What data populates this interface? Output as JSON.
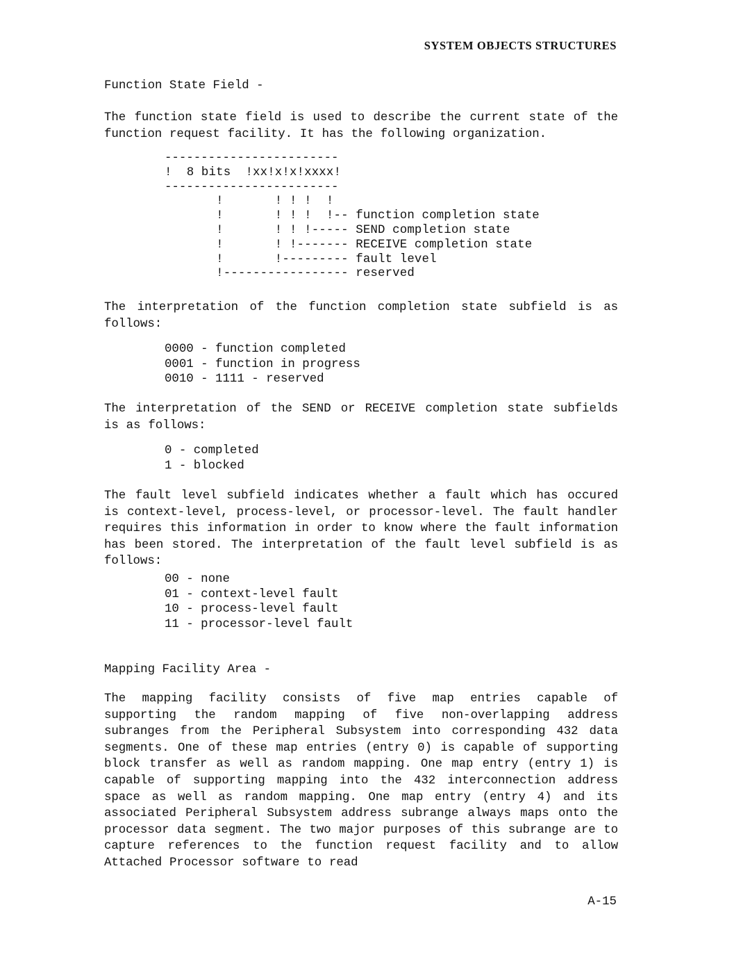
{
  "document": {
    "running_head": "SYSTEM OBJECTS STRUCTURES",
    "page_number": "A-15"
  },
  "sections": {
    "function_state_field": {
      "heading": "Function State Field -",
      "intro": "The function state field is used to describe the current state of the function request facility.  It has the following organization.",
      "diagram": {
        "top_rule": "------------------------",
        "header_row": "!  8 bits  !xx!x!x!xxxx!",
        "bottom_rule": "------------------------",
        "lines": [
          "       !       ! ! !  !",
          "       !       ! ! !  !-- function completion state",
          "       !       ! ! !----- SEND completion state",
          "       !       ! !------- RECEIVE completion state",
          "       !       !--------- fault level",
          "       !----------------- reserved"
        ],
        "callouts": [
          "function completion state",
          "SEND completion state",
          "RECEIVE completion state",
          "fault level",
          "reserved"
        ]
      },
      "completion_state_intro": "The interpretation of the function completion state subfield is as follows:",
      "completion_state_values": [
        "0000 - function completed",
        "0001 - function in progress",
        "0010 - 1111 - reserved"
      ],
      "send_receive_intro": "The interpretation of the SEND or RECEIVE completion state subfields is as follows:",
      "send_receive_values": [
        "0 - completed",
        "1 - blocked"
      ],
      "fault_level_intro": "The fault level subfield indicates whether a fault which has occured is context-level, process-level, or processor-level.  The fault handler requires this information in order to know where the fault information has been stored.  The interpretation of the fault level subfield is as follows:",
      "fault_level_values": [
        "00 - none",
        "01 - context-level fault",
        "10 - process-level fault",
        "11 - processor-level fault"
      ]
    },
    "mapping_facility_area": {
      "heading": "Mapping Facility Area -",
      "body": "The mapping facility consists of five map entries capable of supporting the random mapping of five non-overlapping address subranges from the Peripheral Subsystem into corresponding 432 data segments.  One of these map entries (entry 0) is capable of supporting block transfer as well as random mapping.  One map entry (entry 1) is capable of supporting mapping into the 432 interconnection address space as well as random mapping.  One map entry (entry 4) and its associated Peripheral Subsystem address subrange always maps onto the processor data segment.  The two major purposes of this subrange are to capture references to the function request facility and to allow Attached Processor software to read"
    }
  }
}
